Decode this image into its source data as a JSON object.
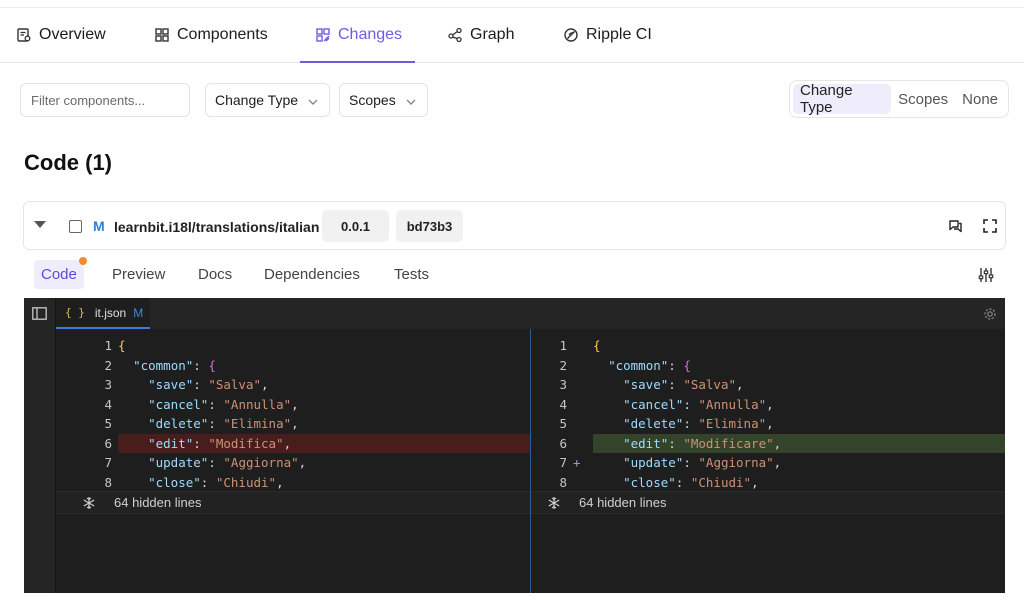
{
  "tabs": [
    {
      "label": "Overview",
      "icon": "overview-icon"
    },
    {
      "label": "Components",
      "icon": "components-icon"
    },
    {
      "label": "Changes",
      "icon": "changes-icon",
      "active": true
    },
    {
      "label": "Graph",
      "icon": "graph-icon"
    },
    {
      "label": "Ripple CI",
      "icon": "ripple-ci-icon"
    }
  ],
  "filters": {
    "search_placeholder": "Filter components...",
    "change_type_label": "Change Type",
    "scopes_label": "Scopes"
  },
  "group_by": {
    "options": [
      "Change Type",
      "Scopes",
      "None"
    ],
    "selected": "Change Type"
  },
  "section_title": "Code (1)",
  "component": {
    "status_badge": "M",
    "name": "learnbit.i18l/translations/italian",
    "version": "0.0.1",
    "hash": "bd73b3"
  },
  "subtabs": [
    "Code",
    "Preview",
    "Docs",
    "Dependencies",
    "Tests"
  ],
  "editor": {
    "file_name": "it.json",
    "file_status": "M",
    "hidden_lines_label": "64 hidden lines",
    "left_lines": [
      {
        "n": "1",
        "text": "{"
      },
      {
        "n": "2",
        "text": "  \"common\": {"
      },
      {
        "n": "3",
        "text": "    \"save\": \"Salva\","
      },
      {
        "n": "4",
        "text": "    \"cancel\": \"Annulla\","
      },
      {
        "n": "5",
        "text": "    \"delete\": \"Elimina\","
      },
      {
        "n": "6",
        "text": "    \"edit\": \"Modifica\",",
        "change": "removed"
      },
      {
        "n": "7",
        "text": "    \"update\": \"Aggiorna\","
      },
      {
        "n": "8",
        "text": "    \"close\": \"Chiudi\","
      }
    ],
    "right_lines": [
      {
        "n": "1",
        "text": "{"
      },
      {
        "n": "2",
        "text": "  \"common\": {"
      },
      {
        "n": "3",
        "text": "    \"save\": \"Salva\","
      },
      {
        "n": "4",
        "text": "    \"cancel\": \"Annulla\","
      },
      {
        "n": "5",
        "text": "    \"delete\": \"Elimina\","
      },
      {
        "n": "6",
        "text": "    \"edit\": \"Modificare\",",
        "change": "added"
      },
      {
        "n": "7",
        "text": "    \"update\": \"Aggiorna\",",
        "marker": "+"
      },
      {
        "n": "8",
        "text": "    \"close\": \"Chiudi\","
      }
    ]
  },
  "colors": {
    "accent": "#6c5ce7",
    "modified_badge": "#2d7fd8",
    "notification_dot": "#f08c2b",
    "removed_line_bg": "#4a1d1d",
    "added_line_bg": "#33442a"
  }
}
